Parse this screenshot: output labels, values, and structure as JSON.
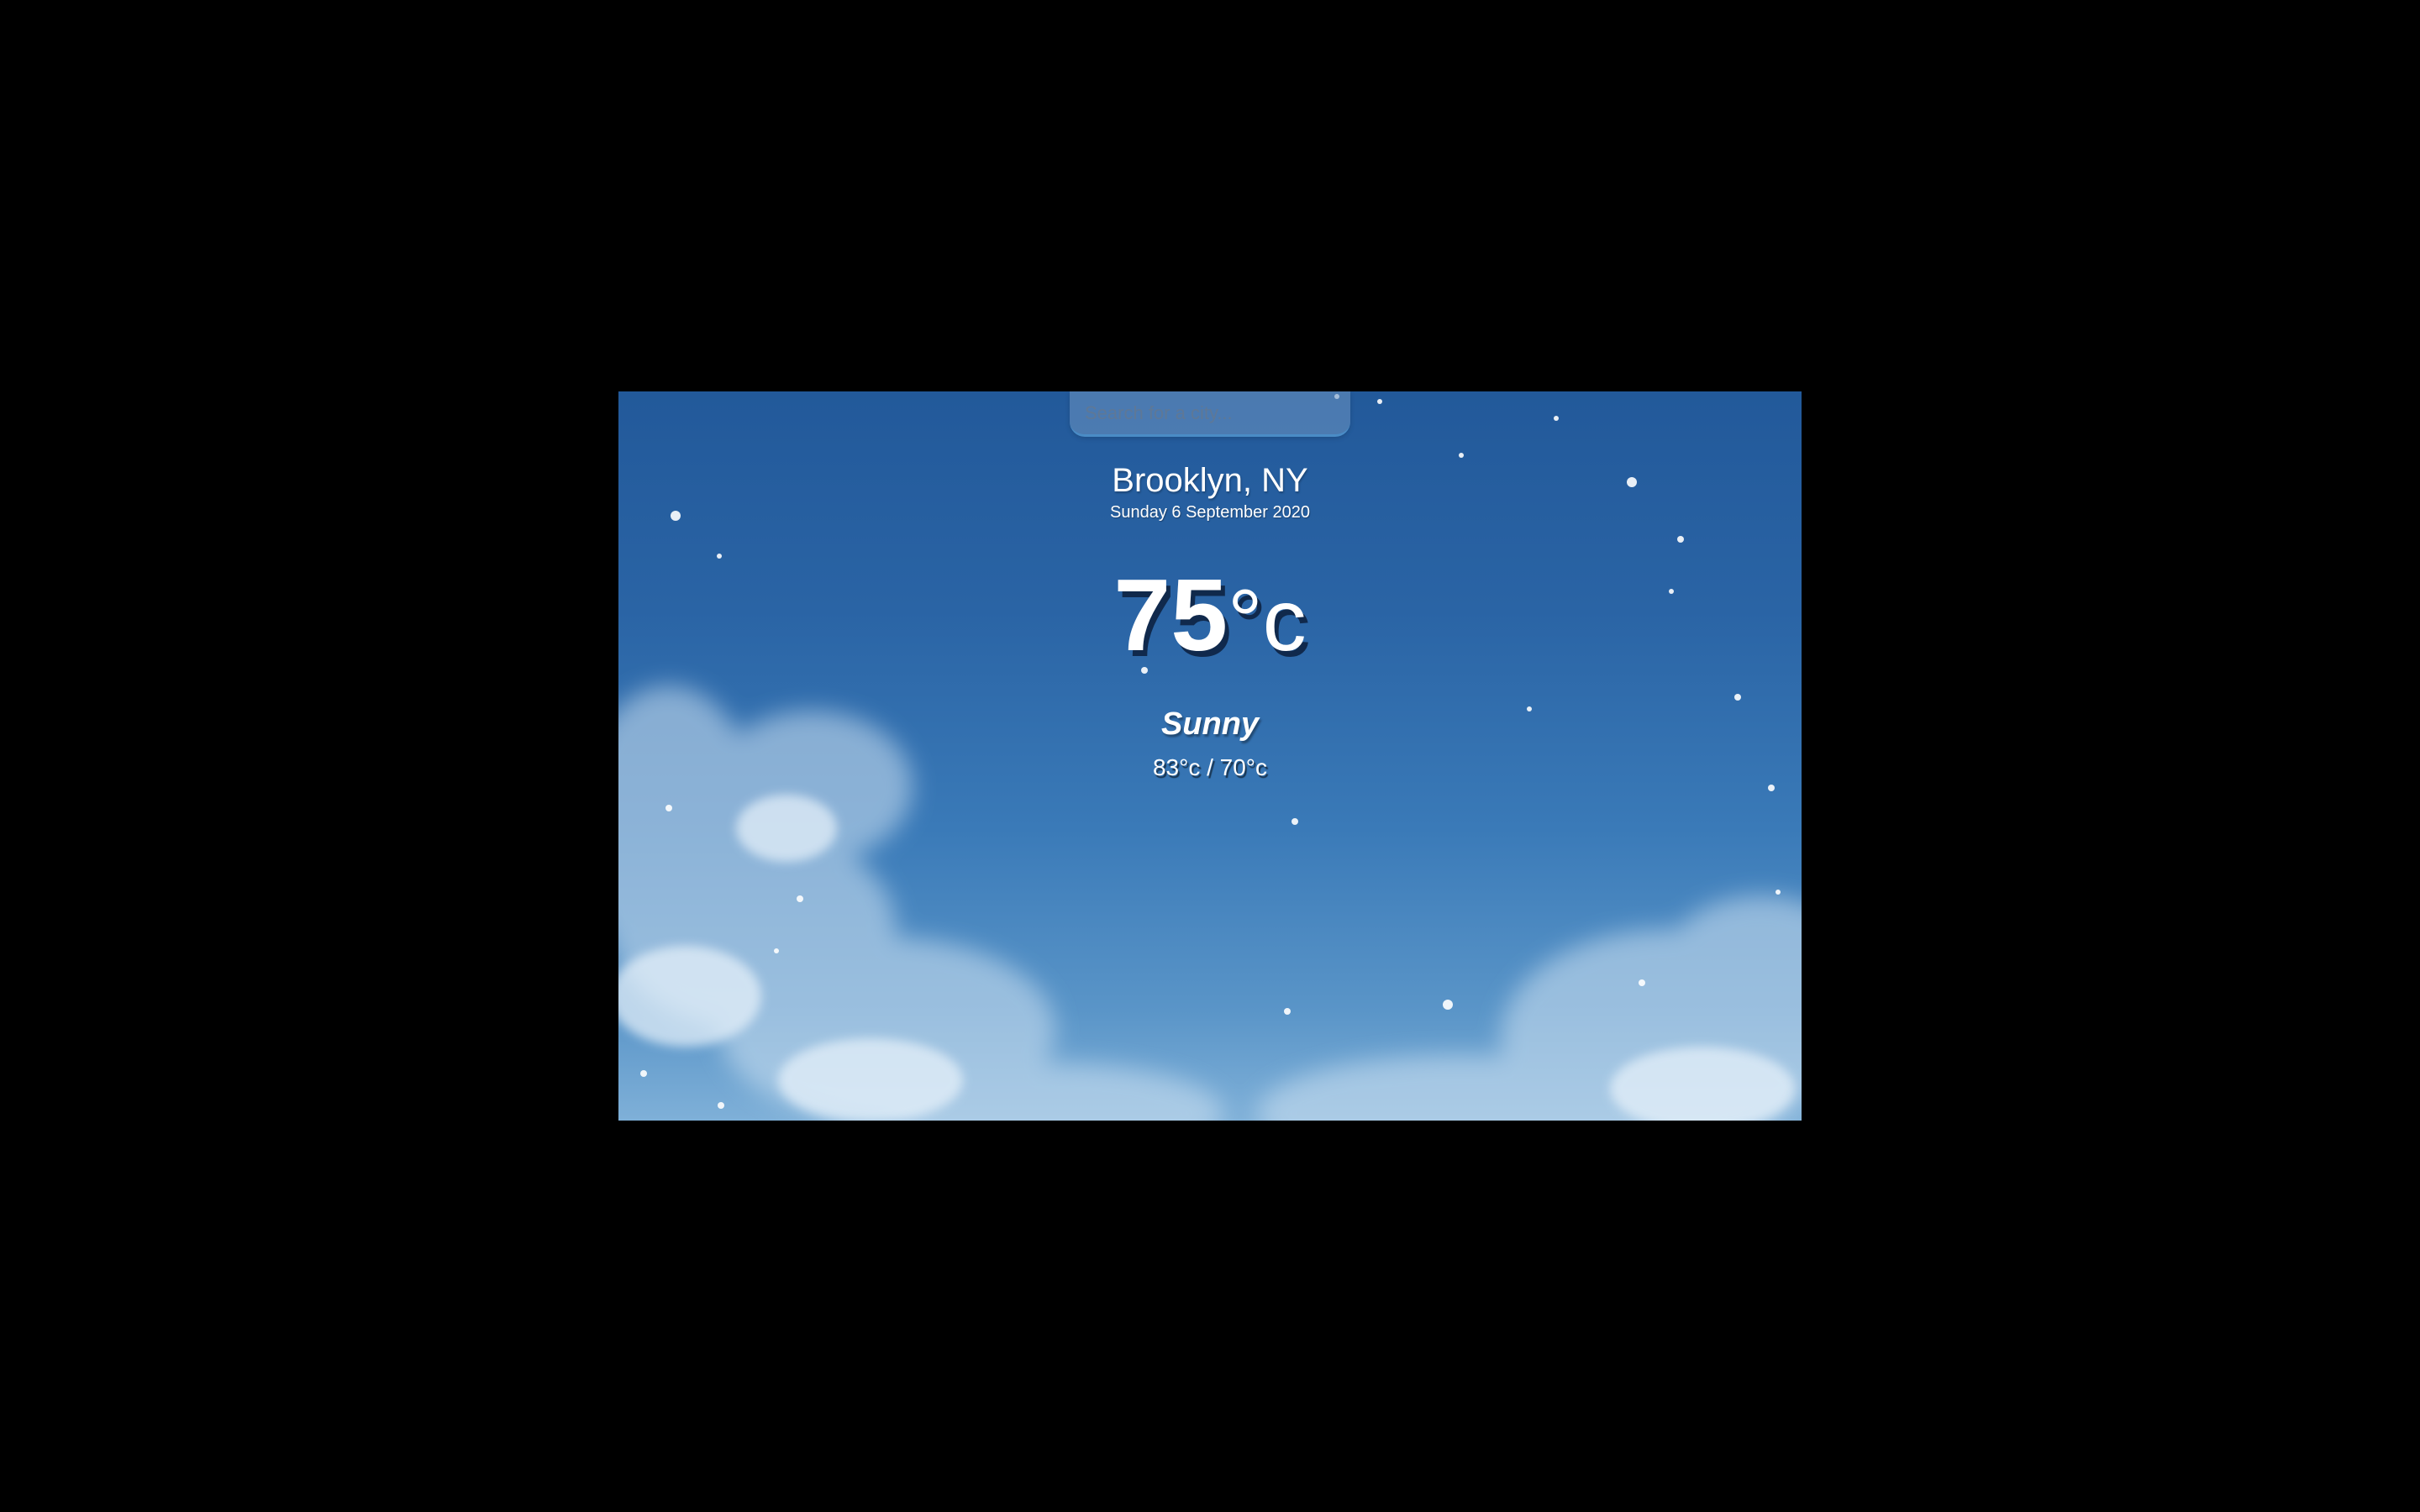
{
  "search": {
    "placeholder": "Search for a city...",
    "value": ""
  },
  "location": {
    "city": "Brooklyn, NY",
    "date": "Sunday 6 September 2020"
  },
  "weather": {
    "temperature": "75",
    "unit": "°c",
    "condition": "Sunny",
    "high_low": "83°c / 70°c"
  },
  "colors": {
    "page_background": "#000000",
    "sky_top": "#22599a",
    "sky_bottom": "#7fb0d8",
    "text": "#ffffff",
    "search_border": "#4a8cc6"
  }
}
